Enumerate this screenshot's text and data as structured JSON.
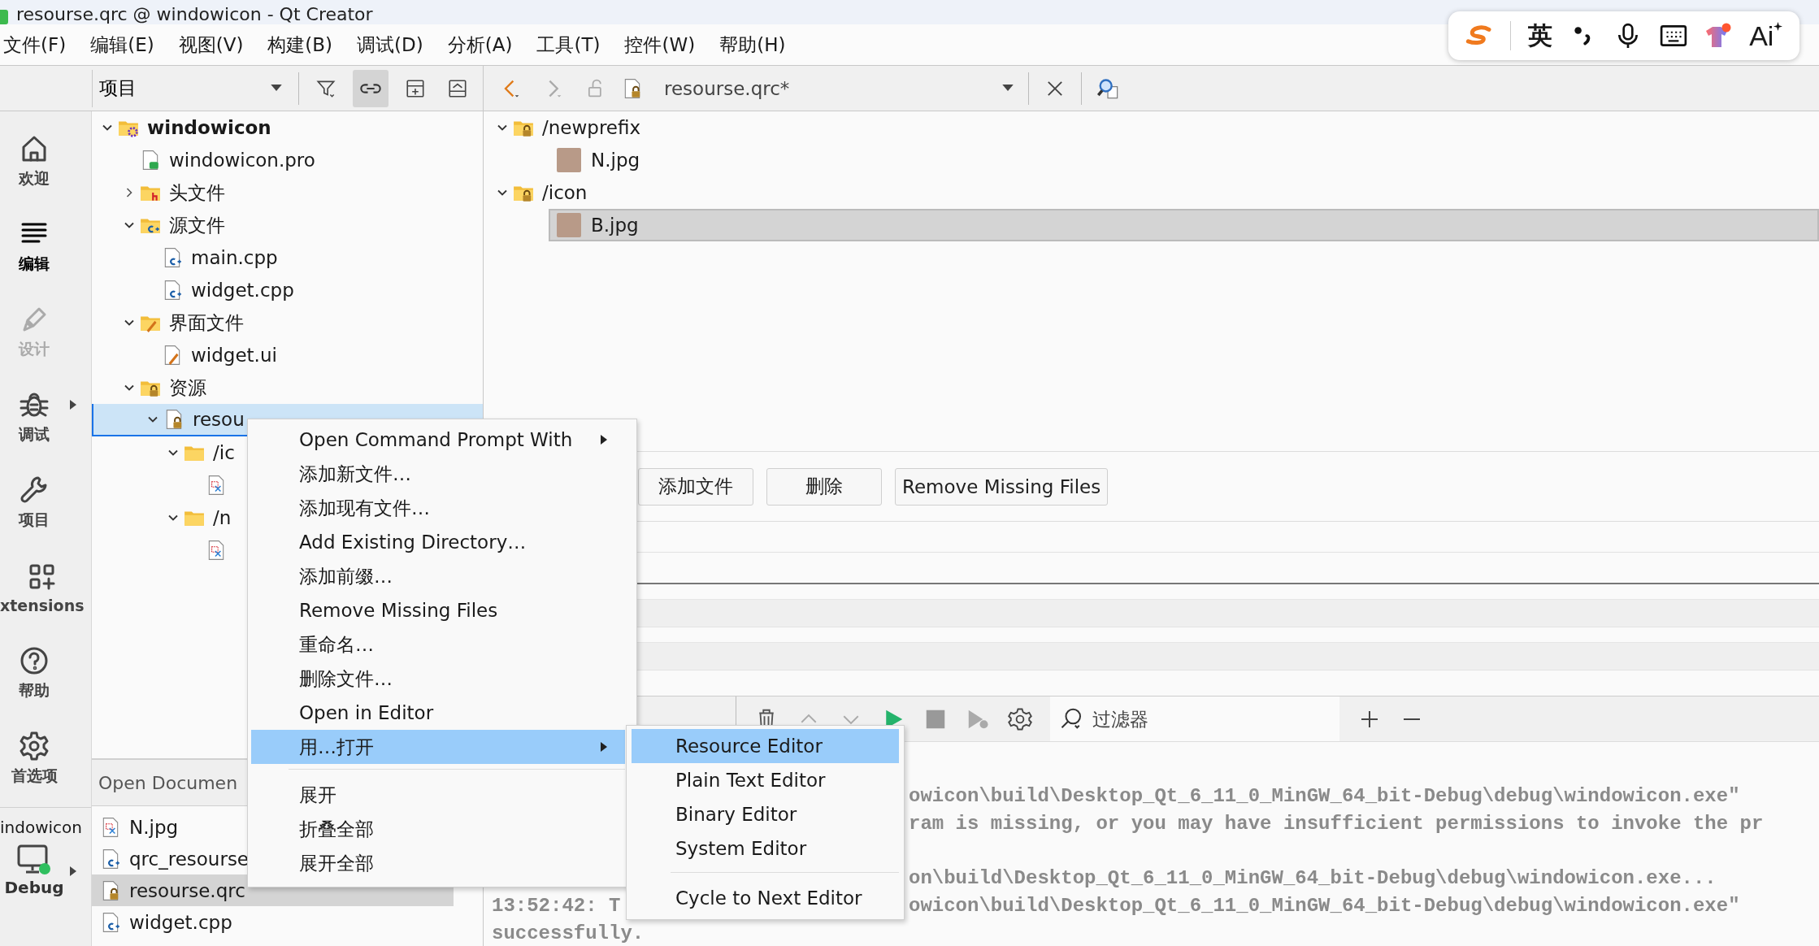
{
  "window": {
    "title": "resourse.qrc @ windowicon - Qt Creator"
  },
  "ime_toolbar": {
    "language": "英",
    "assistant": "Ai"
  },
  "menu_bar": [
    "文件(F)",
    "编辑(E)",
    "视图(V)",
    "构建(B)",
    "调试(D)",
    "分析(A)",
    "工具(T)",
    "控件(W)",
    "帮助(H)"
  ],
  "mode_sidebar": {
    "modes": [
      {
        "kind": "welcome",
        "label": "欢迎",
        "selected": false,
        "disabled": false
      },
      {
        "kind": "edit",
        "label": "编辑",
        "selected": true,
        "disabled": false
      },
      {
        "kind": "design",
        "label": "设计",
        "selected": false,
        "disabled": true
      },
      {
        "kind": "debug",
        "label": "调试",
        "selected": false,
        "disabled": false
      },
      {
        "kind": "projects",
        "label": "项目",
        "selected": false,
        "disabled": false
      },
      {
        "kind": "extensions",
        "label": "xtensions",
        "selected": false,
        "disabled": false
      },
      {
        "kind": "help",
        "label": "帮助",
        "selected": false,
        "disabled": false
      },
      {
        "kind": "preferences",
        "label": "首选项",
        "selected": false,
        "disabled": false
      }
    ],
    "kit": {
      "project": "indowicon",
      "build": "Debug"
    }
  },
  "project_pane": {
    "view": "项目",
    "sync_with_editor": true,
    "tree": [
      {
        "kind": "project",
        "label": "windowicon",
        "expanded": true,
        "selected": false,
        "children": [
          {
            "kind": "pro-file",
            "label": "windowicon.pro",
            "selected": false
          },
          {
            "kind": "header-folder",
            "label": "头文件",
            "expanded": false,
            "selected": false
          },
          {
            "kind": "source-folder",
            "label": "源文件",
            "expanded": true,
            "selected": false,
            "children": [
              {
                "kind": "cpp-file",
                "label": "main.cpp",
                "selected": false
              },
              {
                "kind": "cpp-file",
                "label": "widget.cpp",
                "selected": false
              }
            ]
          },
          {
            "kind": "form-folder",
            "label": "界面文件",
            "expanded": true,
            "selected": false,
            "children": [
              {
                "kind": "ui-file",
                "label": "widget.ui",
                "selected": false
              }
            ]
          },
          {
            "kind": "resource-folder",
            "label": "资源",
            "expanded": true,
            "selected": false,
            "children": [
              {
                "kind": "qrc-file",
                "label": "resou",
                "expanded": true,
                "selected": true,
                "children": [
                  {
                    "kind": "prefix-folder",
                    "label": "/ic",
                    "expanded": true,
                    "selected": false,
                    "children": [
                      {
                        "kind": "image-file",
                        "selected": false
                      }
                    ]
                  },
                  {
                    "kind": "prefix-folder",
                    "label": "/n",
                    "expanded": true,
                    "selected": false,
                    "children": [
                      {
                        "kind": "image-file",
                        "selected": false
                      }
                    ]
                  }
                ]
              }
            ]
          }
        ]
      }
    ],
    "open_documents": {
      "title": "Open Documen",
      "items": [
        {
          "kind": "image-file",
          "label": "N.jpg",
          "selected": false
        },
        {
          "kind": "cpp-file",
          "label": "qrc_resourse",
          "selected": false
        },
        {
          "kind": "qrc-file",
          "label": "resourse.qrc",
          "selected": true
        },
        {
          "kind": "cpp-file",
          "label": "widget.cpp",
          "selected": false
        }
      ]
    }
  },
  "editor": {
    "document": "resourse.qrc*",
    "resources": [
      {
        "label": "/newprefix",
        "expanded": true,
        "selected": false,
        "children": [
          {
            "label": "N.jpg",
            "selected": false
          }
        ]
      },
      {
        "label": "/icon",
        "expanded": true,
        "selected": false,
        "children": [
          {
            "label": "B.jpg",
            "selected": true
          }
        ]
      }
    ],
    "buttons": [
      "添加文件",
      "删除",
      "Remove Missing Files"
    ]
  },
  "output": {
    "filter_placeholder": "过滤器",
    "blocks": [
      [
        {
          "after": "owicon\\build\\Desktop_Qt_6_11_0_MinGW_64_bit-Debug\\debug\\windowicon.exe\""
        },
        {
          "after": "ram is missing, or you may have insufficient permissions to invoke the pr"
        }
      ],
      [
        {
          "after": "on\\build\\Desktop_Qt_6_11_0_MinGW_64_bit-Debug\\debug\\windowicon.exe..."
        },
        {
          "before": "13:52:42: T",
          "after": "owicon\\build\\Desktop_Qt_6_11_0_MinGW_64_bit-Debug\\debug\\windowicon.exe\""
        },
        {
          "before": "successfully."
        }
      ]
    ]
  },
  "context_menu": {
    "items": [
      {
        "kind": "submenu",
        "label": "Open Command Prompt With",
        "selected": false
      },
      {
        "kind": "action",
        "label": "添加新文件…",
        "selected": false
      },
      {
        "kind": "action",
        "label": "添加现有文件…",
        "selected": false
      },
      {
        "kind": "action",
        "label": "Add Existing Directory…",
        "selected": false
      },
      {
        "kind": "action",
        "label": "添加前缀…",
        "selected": false
      },
      {
        "kind": "action",
        "label": "Remove Missing Files",
        "selected": false
      },
      {
        "kind": "action",
        "label": "重命名…",
        "selected": false
      },
      {
        "kind": "action",
        "label": "删除文件…",
        "selected": false
      },
      {
        "kind": "action",
        "label": "Open in Editor",
        "selected": false
      },
      {
        "kind": "submenu",
        "label": "用…打开",
        "selected": true
      },
      {
        "kind": "separator"
      },
      {
        "kind": "action",
        "label": "展开",
        "selected": false
      },
      {
        "kind": "action",
        "label": "折叠全部",
        "selected": false
      },
      {
        "kind": "action",
        "label": "展开全部",
        "selected": false
      }
    ]
  },
  "submenu": {
    "items": [
      {
        "kind": "action",
        "label": "Resource Editor",
        "selected": true
      },
      {
        "kind": "action",
        "label": "Plain Text Editor",
        "selected": false
      },
      {
        "kind": "action",
        "label": "Binary Editor",
        "selected": false
      },
      {
        "kind": "action",
        "label": "System Editor",
        "selected": false
      },
      {
        "kind": "separator"
      },
      {
        "kind": "action",
        "label": "Cycle to Next Editor",
        "selected": false
      }
    ]
  }
}
